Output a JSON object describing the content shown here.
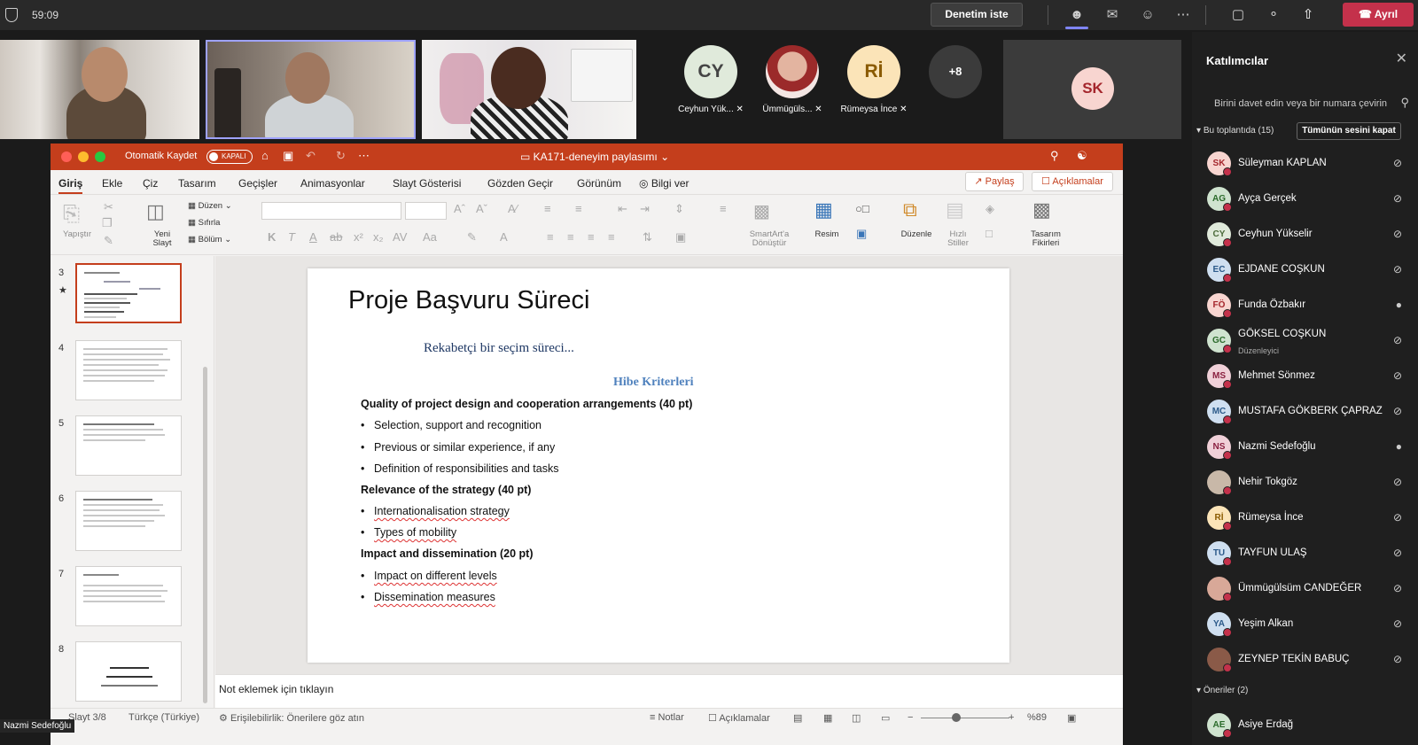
{
  "topbar": {
    "timer": "59:09",
    "request_button": "Denetim iste",
    "leave_button": "Ayrıl"
  },
  "videos": {
    "avatars": [
      {
        "initials": "CY",
        "name": "Ceyhun Yük...",
        "bg": "#e0eadb",
        "fg": "#444"
      },
      {
        "initials": "",
        "name": "Ümmügüls...",
        "bg": "#e8d8d4",
        "fg": "#444"
      },
      {
        "initials": "Rİ",
        "name": "Rümeysa İnce",
        "bg": "#fbe4b8",
        "fg": "#8a5a00"
      }
    ],
    "overflow": "+8",
    "screen_share_initials": "SK",
    "tile_name_label": "Nazmi Sedefoğlu"
  },
  "ppt": {
    "autosave_label": "Otomatik Kaydet",
    "autosave_state": "KAPALI",
    "doc_title": "KA171-deneyim paylasımı",
    "menus": [
      "Giriş",
      "Ekle",
      "Çiz",
      "Tasarım",
      "Geçişler",
      "Animasyonlar",
      "Slayt Gösterisi",
      "Gözden Geçir",
      "Görünüm"
    ],
    "tell_me": "Bilgi ver",
    "share": "Paylaş",
    "comments": "Açıklamalar",
    "ribbon": {
      "paste": "Yapıştır",
      "new_slide_1": "Yeni",
      "new_slide_2": "Slayt",
      "layout": "Düzen",
      "reset": "Sıfırla",
      "section": "Bölüm",
      "smartart_1": "SmartArt'a",
      "smartart_2": "Dönüştür",
      "picture": "Resim",
      "arrange": "Düzenle",
      "quick_styles_1": "Hızlı",
      "quick_styles_2": "Stiller",
      "designer_1": "Tasarım",
      "designer_2": "Fikirleri"
    },
    "thumb_numbers": [
      "3",
      "4",
      "5",
      "6",
      "7",
      "8"
    ],
    "slide": {
      "title": "Proje Başvuru Süreci",
      "subtitle": "Rekabetçi bir seçim süreci...",
      "criteria_heading": "Hibe Kriterleri",
      "sections": [
        {
          "heading": "Quality of project design and cooperation arrangements (40 pt)",
          "items": [
            "Selection, support and recognition",
            "Previous or similar experience, if any",
            "Definition of responsibilities and tasks"
          ]
        },
        {
          "heading": "Relevance of the strategy (40 pt)",
          "items": [
            "Internationalisation strategy",
            "Types of mobility"
          ]
        },
        {
          "heading": "Impact and dissemination (20 pt)",
          "items": [
            "Impact on different levels",
            "Dissemination measures"
          ]
        }
      ]
    },
    "notes_placeholder": "Not eklemek için tıklayın",
    "status": {
      "slide": "Slayt 3/8",
      "language": "Türkçe (Türkiye)",
      "accessibility": "Erişilebilirlik: Önerilere göz atın",
      "notes": "Notlar",
      "comments": "Açıklamalar",
      "zoom": "%89"
    }
  },
  "participants": {
    "title": "Katılımcılar",
    "invite_placeholder": "Birini davet edin veya bir numara çevirin",
    "in_meeting": "Bu toplantıda (15)",
    "mute_all": "Tümünün sesini kapat",
    "suggestions": "Öneriler (2)",
    "list": [
      {
        "initials": "SK",
        "name": "Süleyman KAPLAN",
        "role": "",
        "bg": "#f8d5d0",
        "fg": "#a4262c",
        "mic": "muted"
      },
      {
        "initials": "AG",
        "name": "Ayça Gerçek",
        "role": "",
        "bg": "#cfe3cf",
        "fg": "#2b6b2b",
        "mic": "muted"
      },
      {
        "initials": "CY",
        "name": "Ceyhun Yükselir",
        "role": "",
        "bg": "#e0eadb",
        "fg": "#4a6a3a",
        "mic": "muted"
      },
      {
        "initials": "EC",
        "name": "EJDANE COŞKUN",
        "role": "",
        "bg": "#cfdff0",
        "fg": "#2c5a8a",
        "mic": "muted"
      },
      {
        "initials": "FÖ",
        "name": "Funda Özbakır",
        "role": "",
        "bg": "#f8d5d0",
        "fg": "#a4262c",
        "mic": "on"
      },
      {
        "initials": "GC",
        "name": "GÖKSEL COŞKUN",
        "role": "Düzenleyici",
        "bg": "#cfe3cf",
        "fg": "#2b6b2b",
        "mic": "muted"
      },
      {
        "initials": "MS",
        "name": "Mehmet Sönmez",
        "role": "",
        "bg": "#f0d0d8",
        "fg": "#8a2040",
        "mic": "muted"
      },
      {
        "initials": "MC",
        "name": "MUSTAFA GÖKBERK ÇAPRAZ",
        "role": "",
        "bg": "#cfdff0",
        "fg": "#2c5a8a",
        "mic": "muted"
      },
      {
        "initials": "NS",
        "name": "Nazmi Sedefoğlu",
        "role": "",
        "bg": "#f0d0d8",
        "fg": "#8a2040",
        "mic": "on"
      },
      {
        "initials": "",
        "name": "Nehir Tokgöz",
        "role": "",
        "bg": "#c8b8a8",
        "fg": "#333",
        "mic": "muted"
      },
      {
        "initials": "Rİ",
        "name": "Rümeysa İnce",
        "role": "",
        "bg": "#fbe4b8",
        "fg": "#8a5a00",
        "mic": "muted"
      },
      {
        "initials": "TU",
        "name": "TAYFUN ULAŞ",
        "role": "",
        "bg": "#cfdff0",
        "fg": "#2c5a8a",
        "mic": "muted"
      },
      {
        "initials": "",
        "name": "Ümmügülsüm CANDEĞER",
        "role": "",
        "bg": "#d8a898",
        "fg": "#333",
        "mic": "muted"
      },
      {
        "initials": "YA",
        "name": "Yeşim Alkan",
        "role": "",
        "bg": "#cfdff0",
        "fg": "#2c5a8a",
        "mic": "muted"
      },
      {
        "initials": "",
        "name": "ZEYNEP TEKİN BABUÇ",
        "role": "",
        "bg": "#8a5a48",
        "fg": "#fff",
        "mic": "muted"
      }
    ],
    "suggested": [
      {
        "initials": "AE",
        "name": "Asiye Erdağ",
        "bg": "#cfe3cf",
        "fg": "#2b6b2b"
      }
    ]
  }
}
